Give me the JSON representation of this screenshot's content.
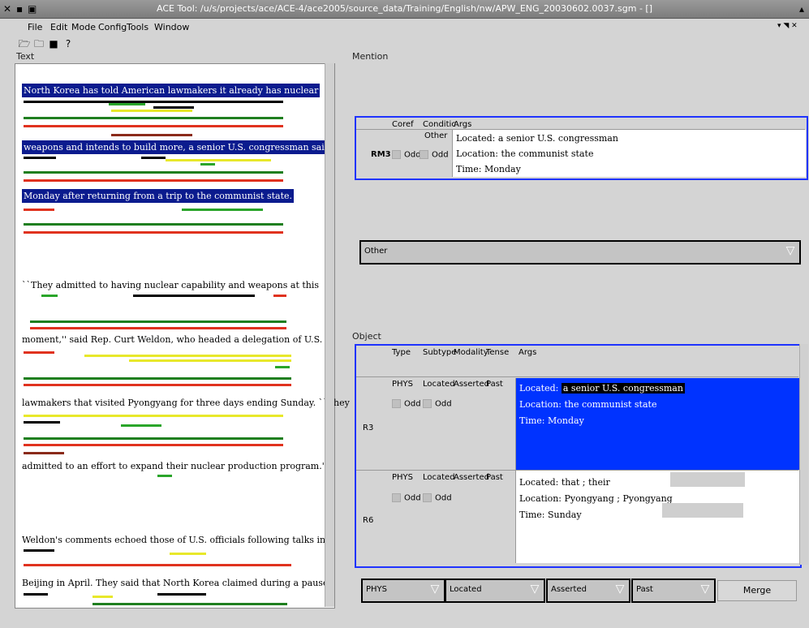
{
  "window": {
    "title": "ACE Tool: /u/s/projects/ace/ACE-4/ace2005/source_data/Training/English/nw/APW_ENG_20030602.0037.sgm - []"
  },
  "menu": [
    "File",
    "Edit",
    "Mode",
    "Config",
    "Tools",
    "Window"
  ],
  "toolbar": {
    "icons": [
      "open-folder-icon",
      "open-folder-2-icon",
      "save-icon",
      "help-icon"
    ]
  },
  "text_panel": {
    "label": "Text",
    "sentences": [
      "North Korea has told American lawmakers it already has nuclear",
      "weapons and intends to build more, a senior U.S. congressman said",
      "Monday after returning from a trip to the communist state.",
      "``They admitted to having nuclear capability and weapons at this",
      "moment,'' said Rep. Curt Weldon, who headed a delegation of U.S.",
      "lawmakers that visited Pyongyang for three days ending Sunday. ``They",
      "admitted to an effort to expand their nuclear production program.''",
      "Weldon's comments echoed those of U.S. officials following talks in",
      "Beijing in April. They said that North Korea claimed during a pause"
    ]
  },
  "mention": {
    "label": "Mention",
    "columns": [
      "Coref",
      "Conditic",
      "Args"
    ],
    "row": {
      "id": "RM3",
      "coref": "Odd",
      "condition_value": "Other",
      "condition_check": "Odd",
      "args": [
        "Located:  a senior U.S. congressman",
        "Location:  the communist state",
        "Time:  Monday"
      ]
    },
    "combo_value": "Other"
  },
  "object": {
    "label": "Object",
    "columns": [
      "Type",
      "Subtype",
      "Modality",
      "Tense",
      "Args"
    ],
    "rows": [
      {
        "id": "R3",
        "type": "PHYS",
        "subtype": "Located",
        "modality": "Asserted",
        "tense": "Past",
        "check1": "Odd",
        "check2": "Odd",
        "args": [
          {
            "label": "Located:",
            "value": "a senior U.S. congressman"
          },
          {
            "label": "Location:",
            "value": "the communist state"
          },
          {
            "label": "Time:",
            "value": "Monday"
          }
        ]
      },
      {
        "id": "R6",
        "type": "PHYS",
        "subtype": "Located",
        "modality": "Asserted",
        "tense": "Past",
        "check1": "Odd",
        "check2": "Odd",
        "args": [
          {
            "label": "Located:",
            "value": "that ;  their"
          },
          {
            "label": "Location:",
            "value": "Pyongyang ;  Pyongyang"
          },
          {
            "label": "Time:",
            "value": "Sunday"
          }
        ]
      }
    ],
    "combos": [
      "PHYS",
      "Located",
      "Asserted",
      "Past"
    ],
    "merge_label": "Merge"
  }
}
